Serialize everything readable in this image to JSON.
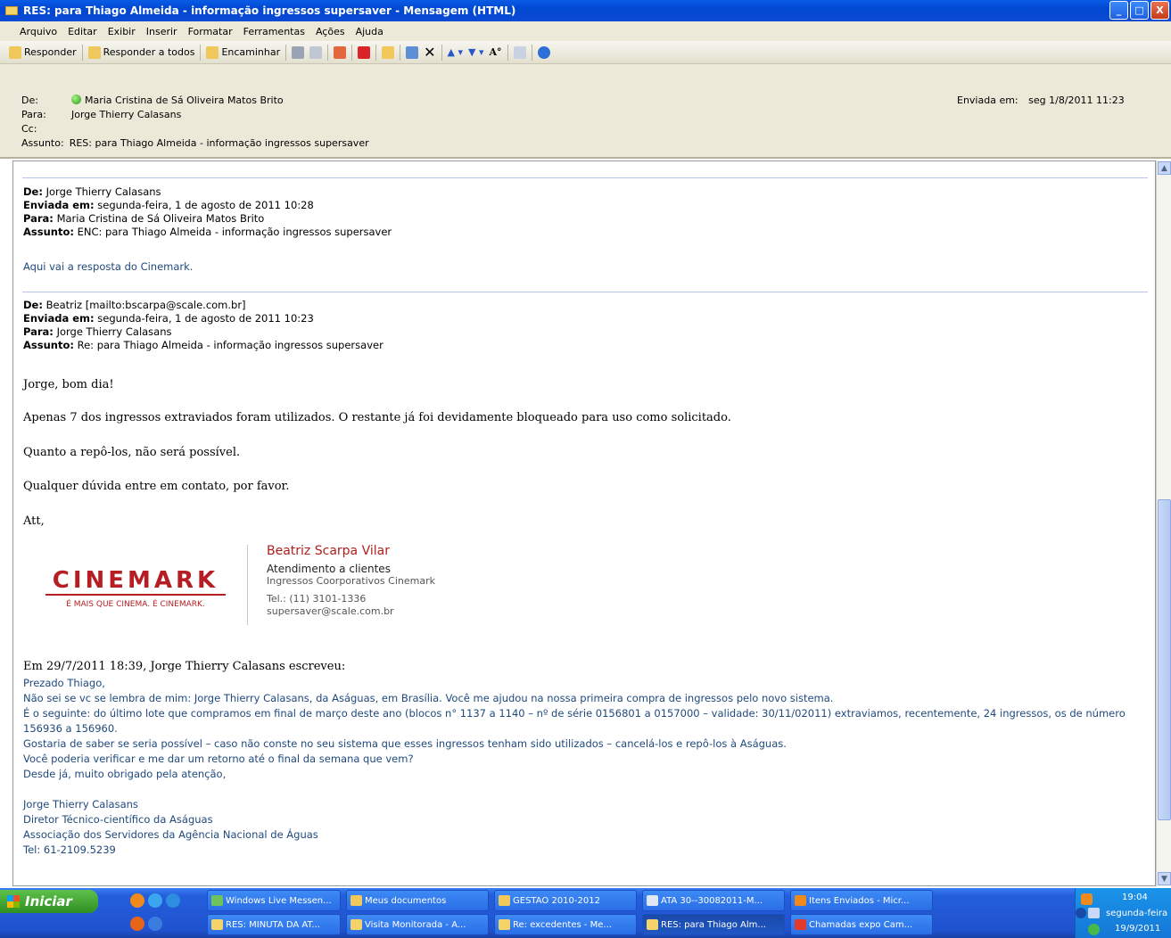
{
  "window": {
    "title": "RES: para Thiago Almeida - informação ingressos supersaver - Mensagem (HTML)",
    "minimize": "_",
    "maximize": "□",
    "close": "X"
  },
  "menu": [
    "Arquivo",
    "Editar",
    "Exibir",
    "Inserir",
    "Formatar",
    "Ferramentas",
    "Ações",
    "Ajuda"
  ],
  "toolbar": {
    "reply": "Responder",
    "reply_all": "Responder a todos",
    "forward": "Encaminhar",
    "font_glyph": "A°"
  },
  "header": {
    "from_label": "De:",
    "from": "Maria Cristina de Sá Oliveira Matos Brito",
    "to_label": "Para:",
    "to": "Jorge Thierry Calasans",
    "cc_label": "Cc:",
    "cc": "",
    "subject_label": "Assunto:",
    "subject": "RES: para Thiago Almeida - informação ingressos supersaver",
    "sent_label": "Enviada em:",
    "sent": "seg 1/8/2011 11:23"
  },
  "fwd1": {
    "from_label": "De:",
    "from": "Jorge Thierry Calasans",
    "sent_label": "Enviada em:",
    "sent": "segunda-feira, 1 de agosto de 2011 10:28",
    "to_label": "Para:",
    "to": "Maria Cristina de Sá Oliveira Matos Brito",
    "subject_label": "Assunto:",
    "subject": "ENC: para Thiago Almeida - informação ingressos supersaver",
    "note": "Aqui vai a resposta do Cinemark."
  },
  "fwd2": {
    "from_label": "De:",
    "from": "Beatriz [mailto:bscarpa@scale.com.br]",
    "sent_label": "Enviada em:",
    "sent": "segunda-feira, 1 de agosto de 2011 10:23",
    "to_label": "Para:",
    "to": "Jorge Thierry Calasans",
    "subject_label": "Assunto:",
    "subject": "Re: para Thiago Almeida - informação ingressos supersaver"
  },
  "reply": {
    "greeting": "Jorge, bom dia!",
    "p1": "Apenas 7 dos ingressos extraviados foram utilizados. O restante já foi devidamente bloqueado para uso como solicitado.",
    "p2": "Quanto a repô-los, não será possível.",
    "p3": "Qualquer dúvida entre em contato, por favor.",
    "closing": "Att,"
  },
  "signature": {
    "logo_text": "CINEMARK",
    "logo_tagline": "É MAIS QUE CINEMA. É CINEMARK.",
    "name": "Beatriz Scarpa Vilar",
    "role": "Atendimento a clientes",
    "dept": "Ingressos Coorporativos Cinemark",
    "phone": "Tel.: (11) 3101-1336",
    "email": "supersaver@scale.com.br"
  },
  "quote": {
    "header": "Em 29/7/2011 18:39, Jorge Thierry Calasans escreveu:",
    "lines": [
      "Prezado Thiago,",
      "Não sei se vc se lembra de mim: Jorge Thierry Calasans, da Aságuas, em Brasília. Você me ajudou na nossa primeira compra de ingressos pelo novo sistema.",
      "É o seguinte: do último lote que compramos em final de março deste ano (blocos n° 1137 a 1140 – nº de série 0156801 a 0157000 – validade: 30/11/02011) extraviamos, recentemente, 24 ingressos, os de número 156936 a 156960.",
      "Gostaria de saber se seria possível – caso não conste no seu sistema que esses ingressos tenham sido utilizados – cancelá-los e repô-los à Aságuas.",
      "Você poderia verificar e me dar um retorno até o final da semana que vem?",
      "Desde já, muito obrigado pela atenção,",
      "",
      "Jorge Thierry Calasans",
      "Diretor Técnico-científico da Aságuas",
      "Associação dos Servidores da Agência Nacional de Águas",
      "Tel: 61-2109.5239"
    ]
  },
  "taskbar": {
    "start": "Iniciar",
    "row1": [
      "Windows Live Messen...",
      "Meus documentos",
      "GESTAO 2010-2012",
      "ATA 30--30082011-M...",
      "Itens Enviados - Micr..."
    ],
    "row2": [
      "RES: MINUTA DA AT...",
      "Visita Monitorada - A...",
      "Re: excedentes - Me...",
      "RES: para Thiago Alm...",
      "Chamadas expo Cam..."
    ],
    "clock": "19:04",
    "day": "segunda-feira",
    "date": "19/9/2011"
  }
}
